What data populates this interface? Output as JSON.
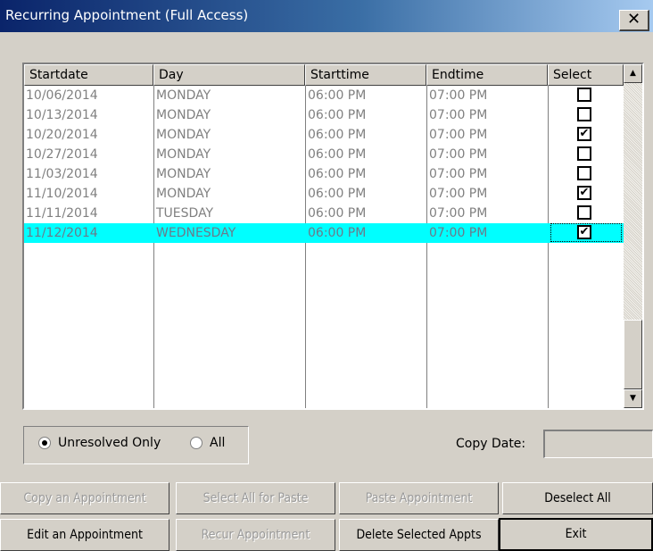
{
  "window": {
    "title": "Recurring Appointment (Full Access)",
    "close_label": "✕"
  },
  "grid": {
    "columns": [
      "Startdate",
      "Day",
      "Starttime",
      "Endtime",
      "Select"
    ],
    "rows": [
      {
        "startdate": "10/06/2014",
        "day": "MONDAY",
        "starttime": "06:00 PM",
        "endtime": "07:00 PM",
        "select": ""
      },
      {
        "startdate": "10/13/2014",
        "day": "MONDAY",
        "starttime": "06:00 PM",
        "endtime": "07:00 PM",
        "select": ""
      },
      {
        "startdate": "10/20/2014",
        "day": "MONDAY",
        "starttime": "06:00 PM",
        "endtime": "07:00 PM",
        "select": "✔"
      },
      {
        "startdate": "10/27/2014",
        "day": "MONDAY",
        "starttime": "06:00 PM",
        "endtime": "07:00 PM",
        "select": ""
      },
      {
        "startdate": "11/03/2014",
        "day": "MONDAY",
        "starttime": "06:00 PM",
        "endtime": "07:00 PM",
        "select": ""
      },
      {
        "startdate": "11/10/2014",
        "day": "MONDAY",
        "starttime": "06:00 PM",
        "endtime": "07:00 PM",
        "select": "✔"
      },
      {
        "startdate": "11/11/2014",
        "day": "TUESDAY",
        "starttime": "06:00 PM",
        "endtime": "07:00 PM",
        "select": ""
      },
      {
        "startdate": "11/12/2014",
        "day": "WEDNESDAY",
        "starttime": "06:00 PM",
        "endtime": "07:00 PM",
        "select": "✔"
      }
    ],
    "selected_row": 8,
    "scroll_up": "▲",
    "scroll_down": "▼"
  },
  "filter": {
    "unresolved_label": "Unresolved Only",
    "all_label": "All",
    "selected": "unresolved"
  },
  "copy_date": {
    "label": "Copy Date:",
    "value": ""
  },
  "buttons": {
    "copy_appointment": "Copy an Appointment",
    "select_all_paste": "Select All  for Paste",
    "paste_appointment": "Paste Appointment",
    "deselect_all": "Deselect All",
    "edit_appointment": "Edit an Appointment",
    "recur_appointment": "Recur Appointment",
    "delete_selected": "Delete Selected Appts",
    "exit": "Exit"
  }
}
